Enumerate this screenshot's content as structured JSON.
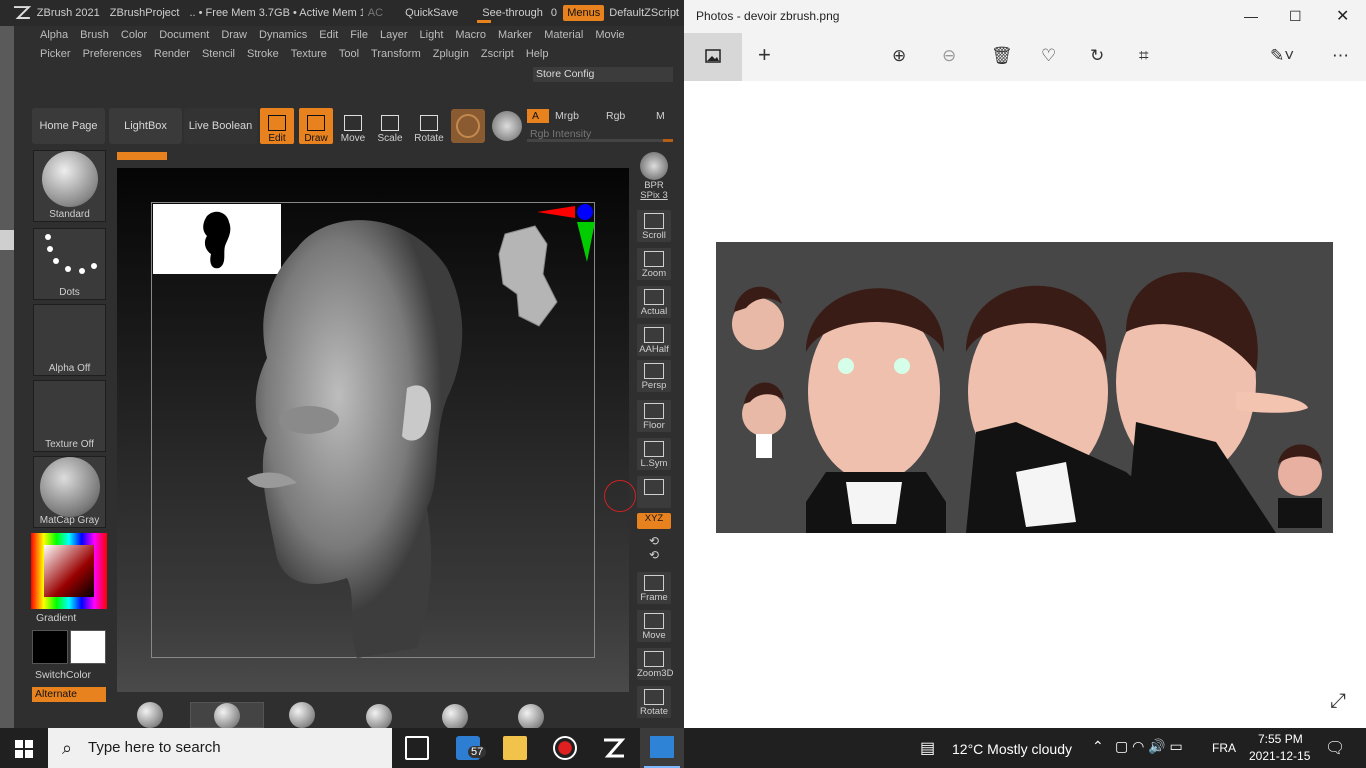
{
  "zbrush": {
    "title": {
      "app": "ZBrush 2021",
      "project": "ZBrushProject",
      "mem": ".. • Free Mem 3.7GB • Active Mem 1",
      "ac": "AC",
      "quicksave": "QuickSave",
      "see_through": "See-through",
      "see_through_value": "0",
      "menus": "Menus",
      "script": "DefaultZScript"
    },
    "menu_row1": [
      "Alpha",
      "Brush",
      "Color",
      "Document",
      "Draw",
      "Dynamics",
      "Edit",
      "File",
      "Layer",
      "Light",
      "Macro",
      "Marker",
      "Material",
      "Movie"
    ],
    "menu_row2": [
      "Picker",
      "Preferences",
      "Render",
      "Stencil",
      "Stroke",
      "Texture",
      "Tool",
      "Transform",
      "Zplugin",
      "Zscript",
      "Help"
    ],
    "store_config": "Store Config",
    "toolbar": {
      "home_page": "Home Page",
      "lightbox": "LightBox",
      "live_boolean": "Live Boolean",
      "edit": "Edit",
      "draw": "Draw",
      "move": "Move",
      "scale": "Scale",
      "rotate": "Rotate",
      "a": "A",
      "mrgb": "Mrgb",
      "rgb": "Rgb",
      "m": "M",
      "rgb_intensity": "Rgb Intensity"
    },
    "left_panel": {
      "brush": "Standard",
      "stroke": "Dots",
      "alpha": "Alpha Off",
      "texture": "Texture Off",
      "material": "MatCap Gray",
      "gradient": "Gradient",
      "switchcolor": "SwitchColor",
      "alternate": "Alternate"
    },
    "right_panel": {
      "bpr": "BPR",
      "spix": "SPix 3",
      "scroll": "Scroll",
      "zoom": "Zoom",
      "actual": "Actual",
      "aahalf": "AAHalf",
      "persp": "Persp",
      "floor": "Floor",
      "lsym": "L.Sym",
      "xyz": "XYZ",
      "frame": "Frame",
      "move": "Move",
      "zoom3d": "Zoom3D",
      "rotate": "Rotate"
    }
  },
  "photos": {
    "title": "Photos - devoir zbrush.png"
  },
  "taskbar": {
    "search_placeholder": "Type here to search",
    "badge": "57",
    "weather": "12°C  Mostly cloudy",
    "lang": "FRA",
    "time": "7:55 PM",
    "date": "2021-12-15"
  }
}
